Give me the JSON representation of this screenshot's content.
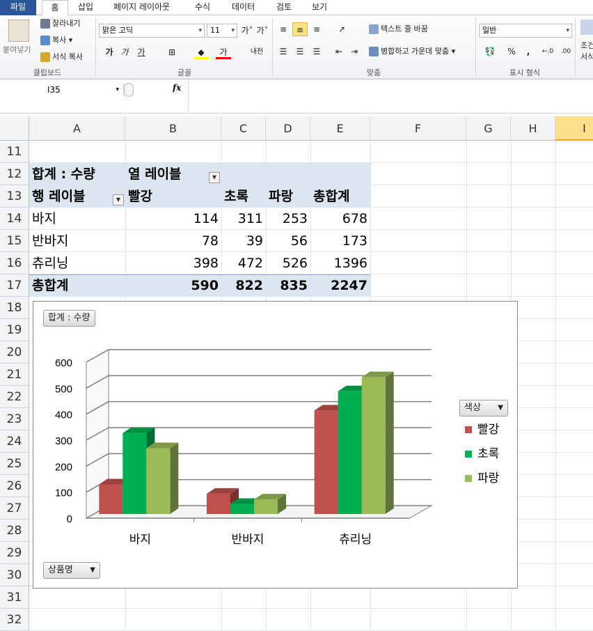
{
  "ribbon_tabs": [
    "파일",
    "홈",
    "삽입",
    "페이지 레이아웃",
    "수식",
    "데이터",
    "검토",
    "보기"
  ],
  "clipboard": {
    "paste": "붙여넣기",
    "cut": "잘라내기",
    "copy": "복사",
    "format_painter": "서식 복사",
    "label": "클립보드"
  },
  "font": {
    "name": "맑은 고딕",
    "size": "11",
    "bold": "가",
    "italic": "가",
    "underline": "가",
    "label": "글꼴"
  },
  "alignment": {
    "wrap_text": "텍스트 줄 바꿈",
    "merge_center": "병합하고 가운데 맞춤",
    "label": "맞춤"
  },
  "number": {
    "format": "일반",
    "percent": "%",
    "comma": ",",
    "label": "표시 형식"
  },
  "styles": {
    "partial": "조건",
    "partial2": "서식"
  },
  "name_box": "I35",
  "fx_label": "fx",
  "columns": [
    "A",
    "B",
    "C",
    "D",
    "E",
    "F",
    "G",
    "H",
    "I"
  ],
  "rows": [
    "11",
    "12",
    "13",
    "14",
    "15",
    "16",
    "17",
    "18",
    "19",
    "20",
    "21",
    "22",
    "23",
    "24",
    "25",
    "26",
    "27",
    "28",
    "29",
    "30",
    "31",
    "32"
  ],
  "pivot": {
    "sum_label": "합계 : 수량",
    "col_labels": "열 레이블",
    "row_labels": "행 레이블",
    "headers": [
      "빨강",
      "초록",
      "파랑",
      "총합계"
    ],
    "rows": [
      {
        "name": "바지",
        "values": [
          "114",
          "311",
          "253",
          "678"
        ]
      },
      {
        "name": "반바지",
        "values": [
          "78",
          "39",
          "56",
          "173"
        ]
      },
      {
        "name": "츄리닝",
        "values": [
          "398",
          "472",
          "526",
          "1396"
        ]
      }
    ],
    "total": {
      "name": "총합계",
      "values": [
        "590",
        "822",
        "835",
        "2247"
      ]
    }
  },
  "chart_data": {
    "type": "bar",
    "categories": [
      "바지",
      "반바지",
      "츄리닝"
    ],
    "series": [
      {
        "name": "빨강",
        "values": [
          114,
          78,
          398
        ],
        "color": "#c0504d"
      },
      {
        "name": "초록",
        "values": [
          311,
          39,
          472
        ],
        "color": "#00b050"
      },
      {
        "name": "파랑",
        "values": [
          253,
          56,
          526
        ],
        "color": "#9bbb59"
      }
    ],
    "ylim": [
      0,
      600
    ],
    "yticks": [
      "0",
      "100",
      "200",
      "300",
      "400",
      "500",
      "600"
    ],
    "value_field_button": "합계 : 수량",
    "legend_field_button": "색상",
    "axis_field_button": "상품명",
    "legend_position": "right",
    "grid": true
  }
}
